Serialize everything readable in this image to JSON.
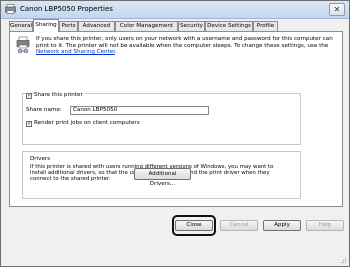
{
  "window": {
    "title": "Canon LBP5050 Properties"
  },
  "tabs": [
    {
      "label": "General",
      "active": false
    },
    {
      "label": "Sharing",
      "active": true
    },
    {
      "label": "Ports",
      "active": false
    },
    {
      "label": "Advanced",
      "active": false
    },
    {
      "label": "Color Management",
      "active": false
    },
    {
      "label": "Security",
      "active": false
    },
    {
      "label": "Device Settings",
      "active": false
    },
    {
      "label": "Profile",
      "active": false
    }
  ],
  "intro": {
    "text": "If you share this printer, only users on your network with a username and password for this computer can print to it. The printer will not be available when the computer sleeps. To change these settings, use the",
    "link": "Network and Sharing Center",
    "tail": "."
  },
  "share": {
    "checkbox_label": "Share this printer",
    "checked": true,
    "name_label": "Share name:",
    "name_value": "Canon LBP5050",
    "render_label": "Render print jobs on client computers",
    "render_checked": true
  },
  "drivers": {
    "title": "Drivers",
    "text": "If this printer is shared with users running different versions of Windows, you may want to install additional drivers, so that the users do not have to find the print driver when they connect to the shared printer.",
    "button": "Additional Drivers..."
  },
  "buttons": {
    "close": "Close",
    "cancel": "Cancel",
    "apply": "Apply",
    "help": "Help"
  },
  "colors": {
    "link": "#0033cc",
    "titlebar": "#c4d7ee"
  }
}
